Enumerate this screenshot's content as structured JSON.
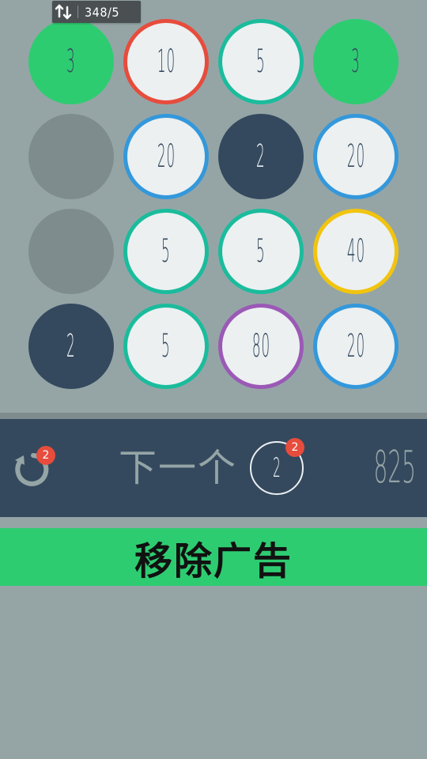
{
  "status_bar": {
    "icon": "sort-swap-icon",
    "text": "348/5"
  },
  "board": {
    "rows": 4,
    "cols": 4,
    "tiles": [
      {
        "value": "3",
        "style": "filled-green"
      },
      {
        "value": "10",
        "style": "ring-red"
      },
      {
        "value": "5",
        "style": "ring-teal"
      },
      {
        "value": "3",
        "style": "filled-green"
      },
      {
        "value": "",
        "style": "empty"
      },
      {
        "value": "20",
        "style": "ring-blue"
      },
      {
        "value": "2",
        "style": "filled-dark"
      },
      {
        "value": "20",
        "style": "ring-blue"
      },
      {
        "value": "",
        "style": "empty"
      },
      {
        "value": "5",
        "style": "ring-teal"
      },
      {
        "value": "5",
        "style": "ring-teal"
      },
      {
        "value": "40",
        "style": "ring-yellow"
      },
      {
        "value": "2",
        "style": "filled-dark"
      },
      {
        "value": "5",
        "style": "ring-teal"
      },
      {
        "value": "80",
        "style": "ring-purple"
      },
      {
        "value": "20",
        "style": "ring-blue"
      }
    ]
  },
  "controls": {
    "undo_icon": "undo-icon",
    "undo_count": "2",
    "next_label": "下一个",
    "next_value": "2",
    "next_count": "2",
    "score": "825"
  },
  "remove_ads": {
    "label": "移除广告"
  },
  "colors": {
    "background": "#95a5a6",
    "board_shadow": "#7f8c8d",
    "panel": "#34495e",
    "green": "#2ecc71",
    "teal": "#1abc9c",
    "red": "#e74c3c",
    "blue": "#3498db",
    "yellow": "#f1c40f",
    "purple": "#9b59b6",
    "tile_face": "#ecf0f1",
    "empty_tile": "#7f8c8d",
    "badge": "#e74c3c"
  }
}
